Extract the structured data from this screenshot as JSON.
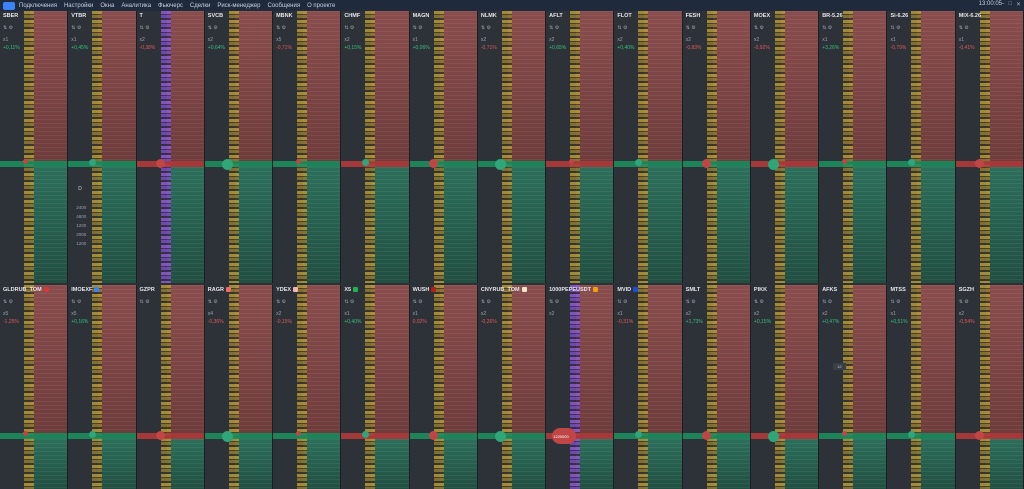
{
  "menu": {
    "items": [
      "Подключения",
      "Настройки",
      "Окна",
      "Аналитика",
      "Фьючерс",
      "Сделки",
      "Риск-менеджер",
      "Сообщения",
      "О проекте"
    ],
    "clock": "13:00:05"
  },
  "top_panels": [
    {
      "ticker": "SBER",
      "x": "x1",
      "pct": "+0,11%",
      "dir": "up"
    },
    {
      "ticker": "VTBR",
      "x": "x1",
      "pct": "+0,45%",
      "dir": "up"
    },
    {
      "ticker": "T",
      "x": "x2",
      "pct": "-0,38%",
      "dir": "dn"
    },
    {
      "ticker": "SVCB",
      "x": "x2",
      "pct": "+0,64%",
      "dir": "up"
    },
    {
      "ticker": "MBNK",
      "x": "x5",
      "pct": "-0,71%",
      "dir": "dn"
    },
    {
      "ticker": "CHMF",
      "x": "x2",
      "pct": "+0,15%",
      "dir": "up"
    },
    {
      "ticker": "MAGN",
      "x": "x1",
      "pct": "+0,06%",
      "dir": "up"
    },
    {
      "ticker": "NLMK",
      "x": "x2",
      "pct": "-0,71%",
      "dir": "dn"
    },
    {
      "ticker": "AFLT",
      "x": "x2",
      "pct": "+0,65%",
      "dir": "up"
    },
    {
      "ticker": "FLOT",
      "x": "x2",
      "pct": "+0,40%",
      "dir": "up"
    },
    {
      "ticker": "FESH",
      "x": "x2",
      "pct": "-0,83%",
      "dir": "dn"
    },
    {
      "ticker": "MOEX",
      "x": "x2",
      "pct": "-0,92%",
      "dir": "dn"
    },
    {
      "ticker": "BR-5.26",
      "x": "x1",
      "pct": "+3,26%",
      "dir": "up"
    },
    {
      "ticker": "Si-6.26",
      "x": "x1",
      "pct": "-0,79%",
      "dir": "dn"
    },
    {
      "ticker": "MIX-6.26",
      "x": "x1",
      "pct": "-0,41%",
      "dir": "dn"
    }
  ],
  "bottom_panels": [
    {
      "ticker": "GLDRUB_TOM",
      "x": "x5",
      "pct": "-1,25%",
      "dir": "dn",
      "color": "#d43a3a"
    },
    {
      "ticker": "IMOEXF",
      "x": "x5",
      "pct": "+0,16%",
      "dir": "up",
      "color": "#3b82f6"
    },
    {
      "ticker": "GZPR",
      "x": "",
      "pct": "",
      "dir": "up",
      "color": ""
    },
    {
      "ticker": "RAGR",
      "x": "x4",
      "pct": "-0,36%",
      "dir": "dn",
      "color": "#f06a6a"
    },
    {
      "ticker": "YDEX",
      "x": "x2",
      "pct": "-0,15%",
      "dir": "dn",
      "color": "#f4b4b4"
    },
    {
      "ticker": "X5",
      "x": "x1",
      "pct": "+0,40%",
      "dir": "up",
      "color": "#22b14c"
    },
    {
      "ticker": "WUSH",
      "x": "x1",
      "pct": "0,02%",
      "dir": "dn",
      "color": "#b91c1c"
    },
    {
      "ticker": "CNYRUB_TOM",
      "x": "x2",
      "pct": "-0,26%",
      "dir": "dn",
      "color": "#f5e6c8"
    },
    {
      "ticker": "1000PEPEUSDT",
      "x": "x2",
      "pct": "",
      "dir": "up",
      "color": "#f59e0b"
    },
    {
      "ticker": "MVID",
      "x": "x1",
      "pct": "-0,31%",
      "dir": "dn",
      "color": "#1d4ed8"
    },
    {
      "ticker": "SMLT",
      "x": "x2",
      "pct": "+1,73%",
      "dir": "up",
      "color": ""
    },
    {
      "ticker": "PIKK",
      "x": "x2",
      "pct": "+0,15%",
      "dir": "up",
      "color": ""
    },
    {
      "ticker": "AFKS",
      "x": "x2",
      "pct": "+0,47%",
      "dir": "up",
      "color": ""
    },
    {
      "ticker": "MTSS",
      "x": "x1",
      "pct": "+0,51%",
      "dir": "up",
      "color": ""
    },
    {
      "ticker": "SGZH",
      "x": "x2",
      "pct": "-0,54%",
      "dir": "dn",
      "color": ""
    }
  ],
  "labels": {
    "d": "D",
    "vol_list": [
      "2400",
      "4800",
      "1200",
      "2000",
      "1200"
    ]
  },
  "spinner_value": "12",
  "big_order": "1220000"
}
